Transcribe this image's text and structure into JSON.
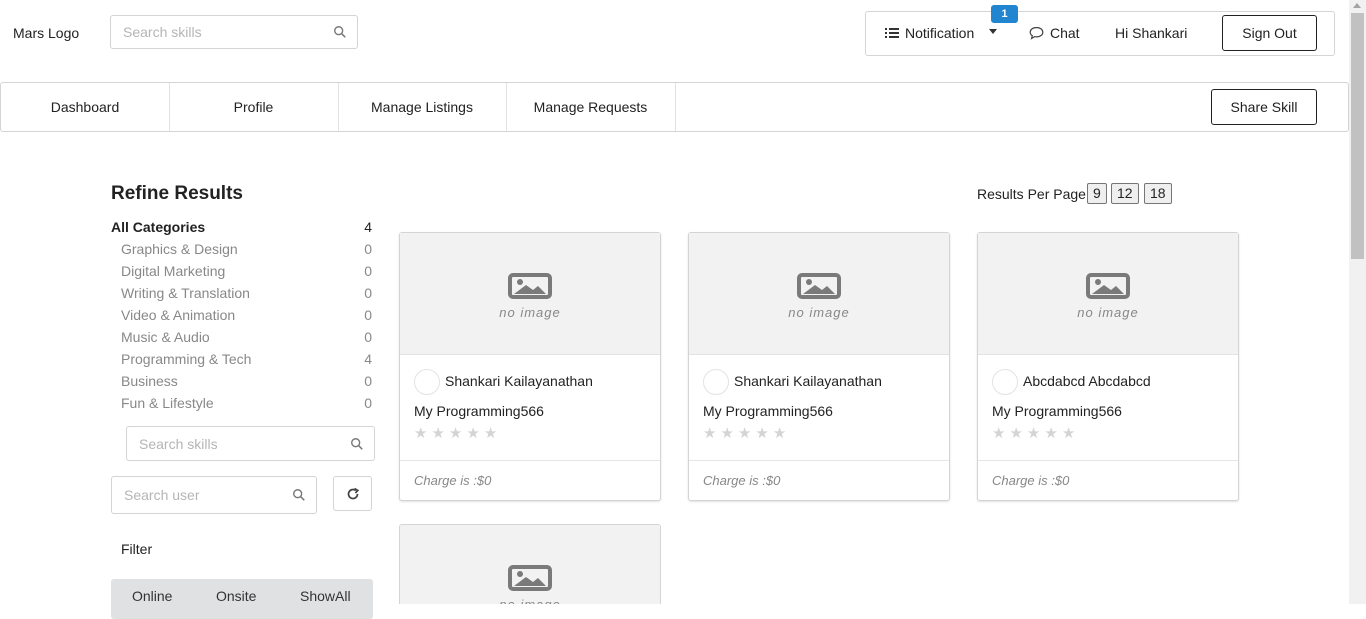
{
  "header": {
    "logo": "Mars Logo",
    "search_placeholder": "Search skills",
    "notification_label": "Notification",
    "notification_count": "1",
    "chat_label": "Chat",
    "greeting": "Hi Shankari",
    "signout_label": "Sign Out"
  },
  "nav": {
    "items": [
      "Dashboard",
      "Profile",
      "Manage Listings",
      "Manage Requests"
    ],
    "share_label": "Share Skill"
  },
  "sidebar": {
    "title": "Refine Results",
    "all_categories": {
      "name": "All Categories",
      "count": "4"
    },
    "categories": [
      {
        "name": "Graphics & Design",
        "count": "0"
      },
      {
        "name": "Digital Marketing",
        "count": "0"
      },
      {
        "name": "Writing & Translation",
        "count": "0"
      },
      {
        "name": "Video & Animation",
        "count": "0"
      },
      {
        "name": "Music & Audio",
        "count": "0"
      },
      {
        "name": "Programming & Tech",
        "count": "4"
      },
      {
        "name": "Business",
        "count": "0"
      },
      {
        "name": "Fun & Lifestyle",
        "count": "0"
      }
    ],
    "skill_search_placeholder": "Search skills",
    "user_search_placeholder": "Search user",
    "filter_label": "Filter",
    "filter_options": [
      "Online",
      "Onsite",
      "ShowAll"
    ]
  },
  "results": {
    "per_page_label": "Results Per Page :",
    "per_page_options": [
      "9",
      "12",
      "18"
    ],
    "no_image_text": "no image",
    "cards": [
      {
        "owner": "Shankari Kailayanathan",
        "title": "My Programming566",
        "charge": "Charge is :$0"
      },
      {
        "owner": "Shankari Kailayanathan",
        "title": "My Programming566",
        "charge": "Charge is :$0"
      },
      {
        "owner": "Abcdabcd Abcdabcd",
        "title": "My Programming566",
        "charge": "Charge is :$0"
      }
    ]
  },
  "colors": {
    "accent": "#2185d0",
    "border": "#d4d4d5",
    "muted_text": "#888888"
  },
  "icons": [
    "search-icon",
    "list-icon",
    "chat-icon",
    "refresh-icon",
    "image-icon",
    "star-icon",
    "caret-down-icon"
  ]
}
